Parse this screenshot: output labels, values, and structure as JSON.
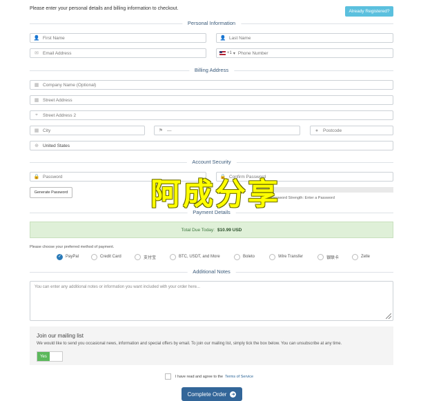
{
  "intro": "Please enter your personal details and billing information to checkout.",
  "already_registered": "Already Registered?",
  "sections": {
    "personal": "Personal Information",
    "billing": "Billing Address",
    "security": "Account Security",
    "payment": "Payment Details",
    "notes": "Additional Notes"
  },
  "personal": {
    "first_name": "First Name",
    "last_name": "Last Name",
    "email": "Email Address",
    "phone_code": "+1",
    "phone": "Phone Number"
  },
  "billing": {
    "company": "Company Name (Optional)",
    "street": "Street Address",
    "street2": "Street Address 2",
    "city": "City",
    "state": "—",
    "postcode": "Postcode",
    "country": "United States"
  },
  "security": {
    "password": "Password",
    "confirm": "Confirm Password",
    "generate": "Generate Password",
    "strength": "Password Strength: Enter a Password"
  },
  "watermark": "阿成分享",
  "payment": {
    "total_label": "Total Due Today:",
    "total_value": "$10.99 USD",
    "choose": "Please choose your preferred method of payment.",
    "methods": [
      "PayPal",
      "Credit Card",
      "支付宝",
      "BTC, USDT, and More",
      "Boleto",
      "Wire Transfer",
      "银联卡",
      "Zelle"
    ],
    "selected": "PayPal"
  },
  "notes": {
    "placeholder": "You can enter any additional notes or information you want included with your order here..."
  },
  "mailing": {
    "heading": "Join our mailing list",
    "text": "We would like to send you occasional news, information and special offers by email. To join our mailing list, simply tick the box below. You can unsubscribe at any time.",
    "toggle": "Yes"
  },
  "tos": {
    "text": "I have read and agree to the",
    "link": "Terms of Service"
  },
  "complete": "Complete Order",
  "colors": {
    "accent": "#336699",
    "info": "#5bc0de",
    "success": "#5cb85c",
    "watermark": "#ffff00"
  }
}
